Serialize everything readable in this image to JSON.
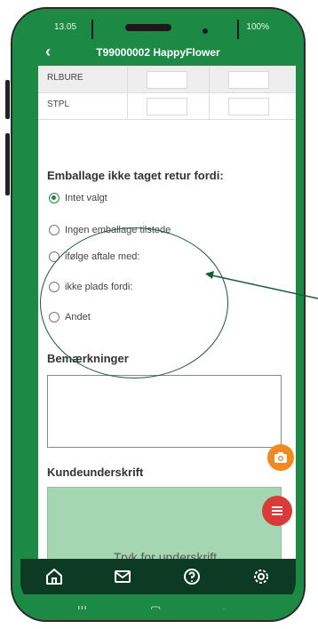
{
  "status": {
    "time": "13.05",
    "battery": "100%"
  },
  "header": {
    "back_icon": "back-icon",
    "title": "T99000002 HappyFlower"
  },
  "table": {
    "rows": [
      {
        "label": "RLBURE"
      },
      {
        "label": "STPL"
      }
    ]
  },
  "packaging": {
    "title": "Emballage ikke taget retur fordi:",
    "options": [
      {
        "label": "Intet valgt",
        "selected": true
      },
      {
        "label": "Ingen emballage tilstede",
        "selected": false
      },
      {
        "label": "ifølge aftale med:",
        "selected": false
      },
      {
        "label": "ikke plads fordi:",
        "selected": false
      },
      {
        "label": "Andet",
        "selected": false
      }
    ]
  },
  "remarks": {
    "title": "Bemærkninger",
    "value": ""
  },
  "signature": {
    "title": "Kundeunderskrift",
    "button_label": "Tryk for underskrift"
  },
  "fab": {
    "camera_icon": "camera-icon",
    "menu_icon": "menu-icon"
  },
  "bottom_nav": {
    "items": [
      "home-icon",
      "mail-icon",
      "help-icon",
      "settings-icon"
    ]
  },
  "system_nav": {
    "items": [
      "recents-icon",
      "home-button-icon",
      "back-nav-icon"
    ]
  },
  "colors": {
    "brand_green": "#1c8a44",
    "dark_nav": "#0d3a22",
    "signature_bg": "#a5d6b2",
    "camera_fab": "#f08a1e",
    "menu_fab": "#d93a3a"
  }
}
